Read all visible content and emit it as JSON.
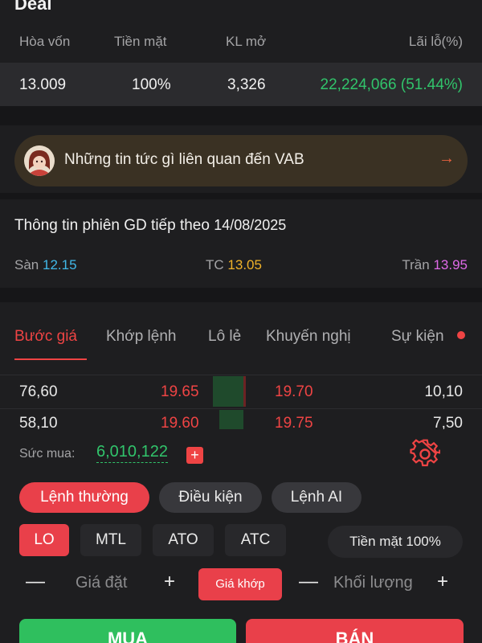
{
  "title": "Deal",
  "summary": {
    "headers": [
      "Hòa vốn",
      "Tiền mặt",
      "KL mở",
      "Lãi lỗ(%)"
    ],
    "values": [
      "13.009",
      "100%",
      "3,326",
      "22,224,066 (51.44%)"
    ]
  },
  "news": {
    "text": "Những tin tức gì liên quan đến VAB",
    "arrow": "→"
  },
  "session": {
    "label": "Thông tin phiên GD tiếp theo",
    "date": "14/08/2025",
    "floor_label": "Sàn",
    "floor": "12.15",
    "ref_label": "TC",
    "ref": "13.05",
    "ceil_label": "Trần",
    "ceil": "13.95"
  },
  "tabs": [
    "Bước giá",
    "Khớp lệnh",
    "Lô lẻ",
    "Khuyến nghị",
    "Sự kiện"
  ],
  "orderbook": [
    {
      "bid_vol": "76,60",
      "bid_price": "19.65",
      "ask_price": "19.70",
      "ask_vol": "10,10"
    },
    {
      "bid_vol": "58,10",
      "bid_price": "19.60",
      "ask_price": "19.75",
      "ask_vol": "7,50"
    }
  ],
  "order_panel": {
    "buying_power_label": "Sức mua:",
    "buying_power": "6,010,122",
    "plus": "+",
    "order_modes": [
      "Lệnh thường",
      "Điều kiện",
      "Lệnh AI"
    ],
    "order_types": [
      "LO",
      "MTL",
      "ATO",
      "ATC"
    ],
    "cash_label": "Tiền mặt 100%",
    "price_placeholder": "Giá đặt",
    "match_label": "Giá khớp",
    "qty_placeholder": "Khối lượng",
    "minus": "—",
    "plus_sign": "+",
    "buy_label": "MUA",
    "sell_label": "BÁN"
  },
  "colors": {
    "accent_red": "#e9404a",
    "green": "#31c46b",
    "floor": "#41b8e8",
    "ref": "#f0b229",
    "ceiling": "#e06ae8"
  }
}
